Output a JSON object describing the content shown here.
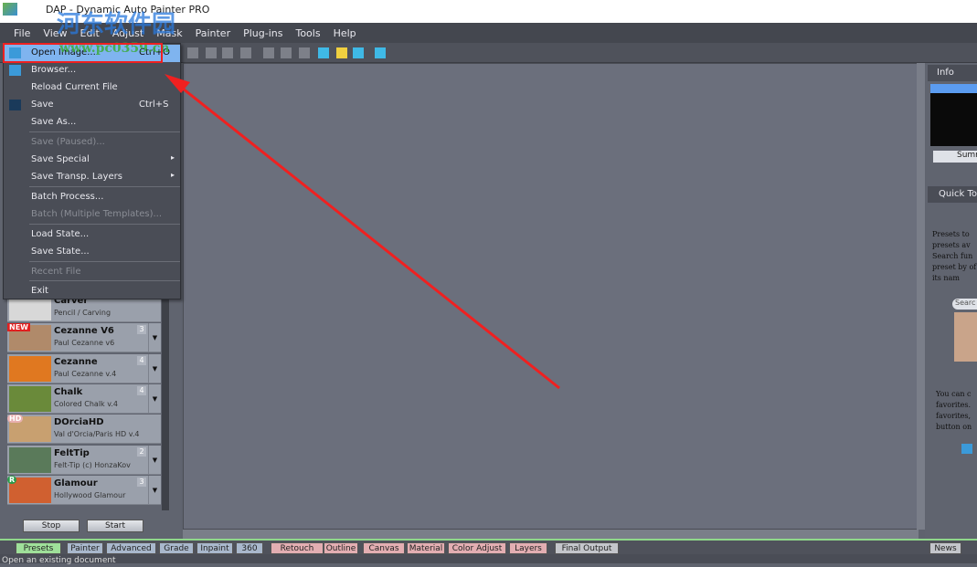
{
  "window": {
    "title": "DAP - Dynamic Auto Painter PRO"
  },
  "watermark": {
    "text": "河东软件园",
    "url": "www.pc0359.cn"
  },
  "menubar": [
    "File",
    "View",
    "Edit",
    "Adjust",
    "Mask",
    "Painter",
    "Plug-ins",
    "Tools",
    "Help"
  ],
  "file_menu": [
    {
      "label": "Open Image...",
      "shortcut": "Ctrl+O",
      "state": "highlighted"
    },
    {
      "label": "Browser..."
    },
    {
      "label": "Reload Current File"
    },
    {
      "label": "Save",
      "shortcut": "Ctrl+S"
    },
    {
      "label": "Save As..."
    },
    {
      "label": "Save (Paused)...",
      "state": "disabled"
    },
    {
      "label": "Save Special",
      "submenu": "▸"
    },
    {
      "label": "Save Transp. Layers",
      "submenu": "▸"
    },
    {
      "label": "Batch Process..."
    },
    {
      "label": "Batch (Multiple Templates)...",
      "state": "disabled"
    },
    {
      "label": "Load State..."
    },
    {
      "label": "Save State..."
    },
    {
      "label": "Recent File",
      "state": "disabled"
    },
    {
      "label": "Exit"
    }
  ],
  "presets": [
    {
      "name": "Carver",
      "sub": "Pencil / Carving",
      "color": "#d8d8d8"
    },
    {
      "name": "Cezanne V6",
      "sub": "Paul Cezanne v6",
      "num": "3",
      "badge": "NEW",
      "color": "#b08a6a"
    },
    {
      "name": "Cezanne",
      "sub": "Paul Cezanne v.4",
      "num": "4",
      "color": "#e07820"
    },
    {
      "name": "Chalk",
      "sub": "Colored Chalk v.4",
      "num": "4",
      "color": "#6a8a3a"
    },
    {
      "name": "DOrciaHD",
      "sub": "Val d'Orcia/Paris HD v.4",
      "badge": "HD",
      "color": "#c8a070"
    },
    {
      "name": "FeltTip",
      "sub": "Felt-Tip (c) HonzaKov",
      "num": "2",
      "color": "#5a7a5a"
    },
    {
      "name": "Glamour",
      "sub": "Hollywood Glamour",
      "num": "3",
      "badge": "R",
      "color": "#d06030"
    }
  ],
  "left_buttons": {
    "stop": "Stop",
    "start": "Start"
  },
  "right_panel": {
    "info_title": "Info",
    "summary": "Summ",
    "quick_title": "Quick To",
    "text1": "Presets to presets av Search fun preset by of its nam",
    "search": "Searc",
    "text2": "You can c favorites. favorites, button on"
  },
  "tabs": [
    {
      "label": "Presets",
      "group": "green"
    },
    {
      "label": "Painter",
      "group": "blue"
    },
    {
      "label": "Advanced",
      "group": "blue"
    },
    {
      "label": "Grade",
      "group": "blue"
    },
    {
      "label": "Inpaint",
      "group": "blue"
    },
    {
      "label": "360",
      "group": "blue"
    },
    {
      "label": "Retouch",
      "group": "pink"
    },
    {
      "label": "Outline",
      "group": "pink"
    },
    {
      "label": "Canvas",
      "group": "pink"
    },
    {
      "label": "Material",
      "group": "pink"
    },
    {
      "label": "Color Adjust",
      "group": "pink"
    },
    {
      "label": "Layers",
      "group": "pink"
    },
    {
      "label": "Final Output",
      "group": "gray"
    },
    {
      "label": "News",
      "group": "gray"
    }
  ],
  "status": "Open an existing document",
  "colors": {
    "highlight": "#7fb4ef",
    "annotation": "#f02020",
    "tab_green": "#9fe09a",
    "tab_blue": "#a9b8cc",
    "tab_pink": "#e3aeb2",
    "tab_gray": "#c4c6cb"
  }
}
